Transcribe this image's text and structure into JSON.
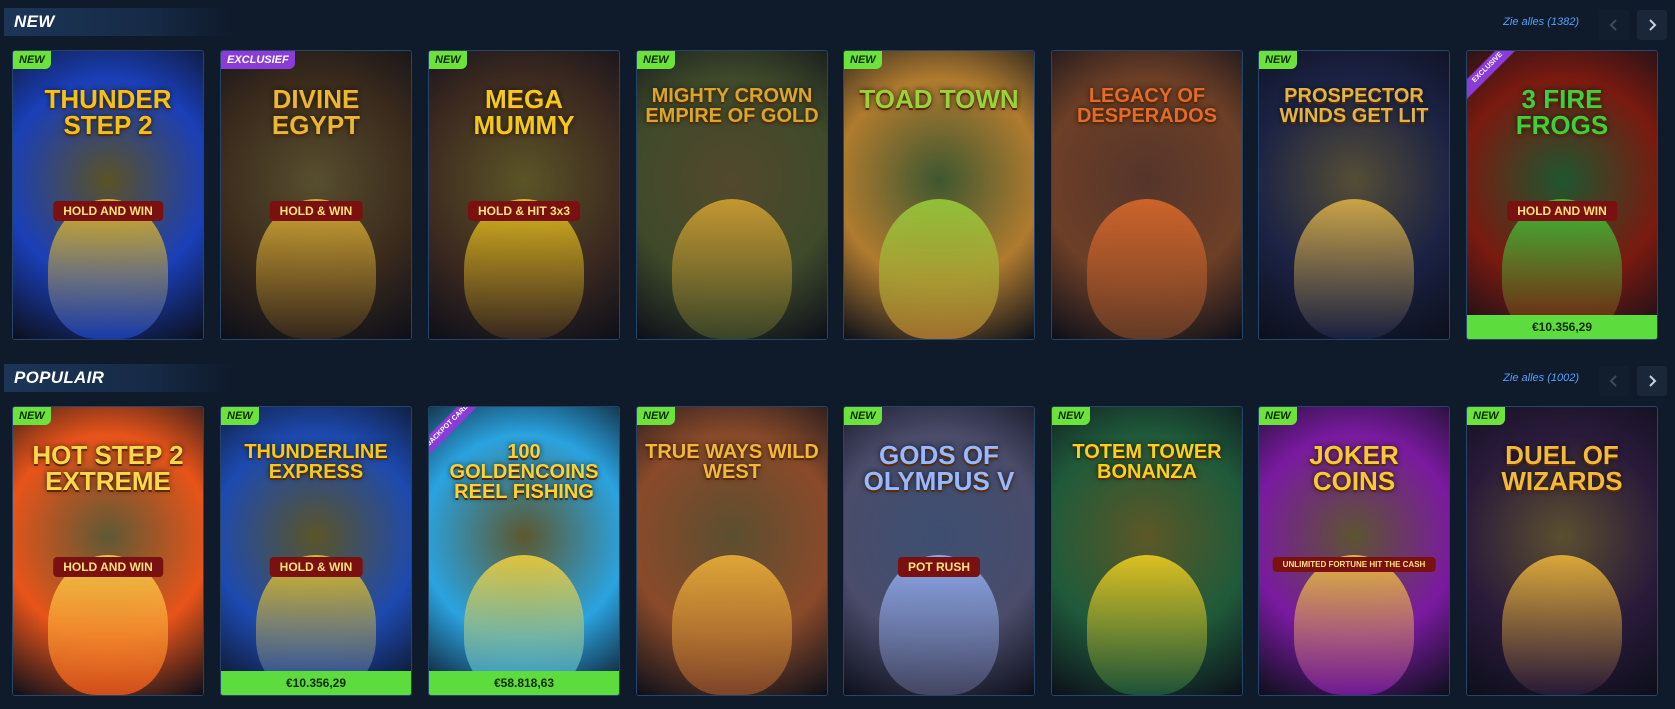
{
  "sections": [
    {
      "title": "NEW",
      "see_all": "Zie alles",
      "count": "(1382)",
      "games": [
        {
          "title": "Thunder Step 2",
          "subtitle": "HOLD AND WIN",
          "badge": "NEW",
          "jackpot": "",
          "bg": "#1a3fb8",
          "accent": "#f2c21a"
        },
        {
          "title": "Divine Egypt",
          "subtitle": "HOLD & WIN",
          "badge": "EXCLUSIEF",
          "jackpot": "",
          "bg": "#3a2a1c",
          "accent": "#e8b736"
        },
        {
          "title": "Mega Mummy",
          "subtitle": "HOLD & HIT 3x3",
          "badge": "NEW",
          "jackpot": "",
          "bg": "#3d2a20",
          "accent": "#f3c91e"
        },
        {
          "title": "Mighty Crown Empire of Gold",
          "subtitle": "",
          "badge": "NEW",
          "jackpot": "",
          "bg": "#3f4a2a",
          "accent": "#d9a531"
        },
        {
          "title": "Toad Town",
          "subtitle": "",
          "badge": "NEW",
          "jackpot": "",
          "bg": "#b07b2f",
          "accent": "#9bd13b"
        },
        {
          "title": "Legacy of Desperados",
          "subtitle": "",
          "badge": "",
          "jackpot": "",
          "bg": "#6d3f27",
          "accent": "#e06b2b"
        },
        {
          "title": "Prospector Winds Get Lit",
          "subtitle": "",
          "badge": "NEW",
          "jackpot": "",
          "bg": "#1b2244",
          "accent": "#e0b44a"
        },
        {
          "title": "3 Fire Frogs",
          "subtitle": "HOLD AND WIN",
          "badge": "",
          "ribbon": "EXCLUSIVE",
          "jackpot": "€10.356,29",
          "bg": "#7a1a10",
          "accent": "#3ecf3a"
        }
      ]
    },
    {
      "title": "POPULAIR",
      "see_all": "Zie alles",
      "count": "(1002)",
      "games": [
        {
          "title": "Hot Step 2 Extreme",
          "subtitle": "HOLD AND WIN",
          "badge": "NEW",
          "jackpot": "",
          "bg": "#e8541a",
          "accent": "#ffd84a"
        },
        {
          "title": "Thunderline Express",
          "subtitle": "HOLD & WIN",
          "badge": "NEW",
          "jackpot": "€10.356,29",
          "bg": "#1d4ab0",
          "accent": "#f3c91e"
        },
        {
          "title": "100 Goldencoins Reel Fishing",
          "subtitle": "",
          "badge": "",
          "ribbon": "JACKPOT CARDS",
          "jackpot": "€58.818,63",
          "bg": "#2aa3e0",
          "accent": "#f7d338"
        },
        {
          "title": "True Ways Wild West",
          "subtitle": "",
          "badge": "NEW",
          "jackpot": "",
          "bg": "#8a4a2a",
          "accent": "#f3b63a"
        },
        {
          "title": "Gods of Olympus V",
          "subtitle": "POT RUSH",
          "badge": "NEW",
          "jackpot": "",
          "bg": "#4a4c6a",
          "accent": "#9ab8ff"
        },
        {
          "title": "Totem Tower Bonanza",
          "subtitle": "",
          "badge": "NEW",
          "jackpot": "",
          "bg": "#1f5a3a",
          "accent": "#f6d21f"
        },
        {
          "title": "Joker Coins",
          "subtitle": "UNLIMITED FORTUNE HIT THE CASH",
          "badge": "NEW",
          "jackpot": "",
          "bg": "#7a1aa0",
          "accent": "#f7c93a"
        },
        {
          "title": "Duel of Wizards",
          "subtitle": "",
          "badge": "NEW",
          "jackpot": "",
          "bg": "#2a1a3a",
          "accent": "#f2b93a"
        }
      ]
    }
  ],
  "colors": {
    "background": "#0f1a2b",
    "new_badge": "#6ce23a",
    "exclusive_badge": "#8a3bd8",
    "jackpot_bar": "#5ddc3e",
    "link": "#4fa3ff"
  }
}
